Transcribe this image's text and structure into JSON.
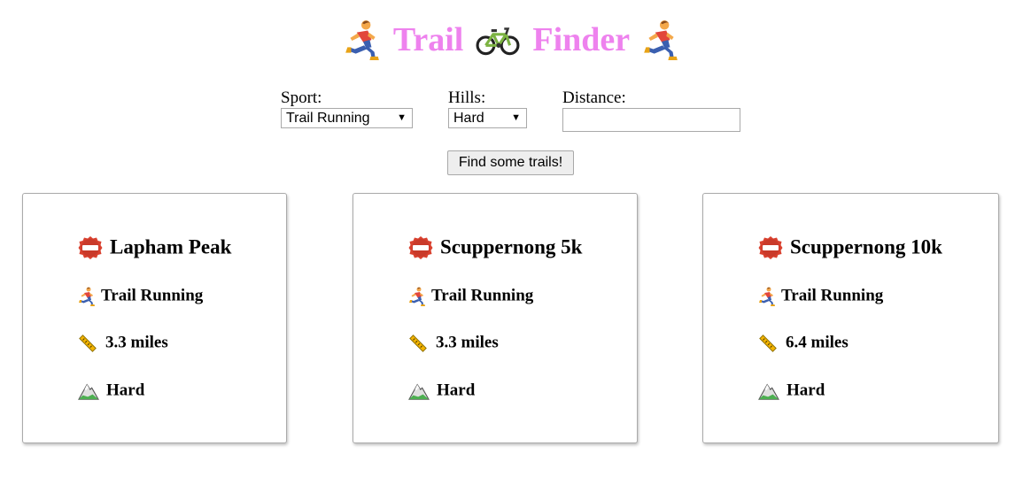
{
  "header": {
    "word1": "Trail",
    "word2": "Finder",
    "title_color": "#ee82ee",
    "icons": [
      "runner-icon",
      "bicycle-icon",
      "runner-icon"
    ]
  },
  "filters": {
    "sport_label": "Sport:",
    "sport_value": "Trail Running",
    "hills_label": "Hills:",
    "hills_value": "Hard",
    "distance_label": "Distance:",
    "distance_value": ""
  },
  "search_button": "Find some trails!",
  "trails": [
    {
      "name": "Lapham Peak",
      "sport": "Trail Running",
      "distance": "3.3 miles",
      "hills": "Hard"
    },
    {
      "name": "Scuppernong 5k",
      "sport": "Trail Running",
      "distance": "3.3 miles",
      "hills": "Hard"
    },
    {
      "name": "Scuppernong 10k",
      "sport": "Trail Running",
      "distance": "6.4 miles",
      "hills": "Hard"
    }
  ],
  "icons": {
    "name": "name-badge-icon",
    "sport": "runner-icon",
    "distance": "ruler-icon",
    "hills": "mountain-icon"
  }
}
